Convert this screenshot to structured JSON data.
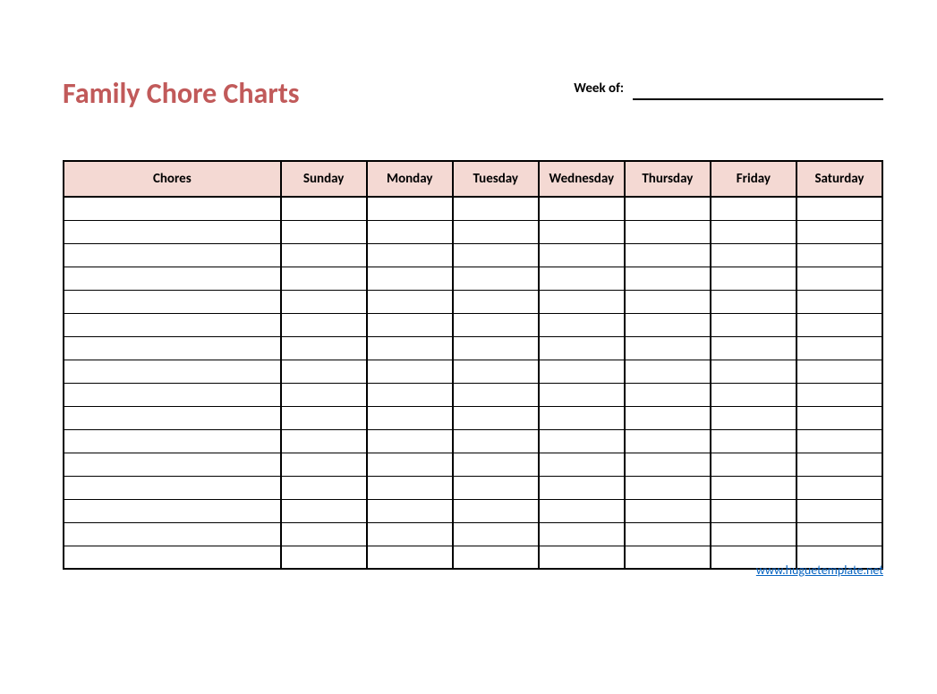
{
  "title": "Family Chore Charts",
  "week_of_label": "Week of:",
  "week_of_value": "",
  "table": {
    "headers": [
      "Chores",
      "Sunday",
      "Monday",
      "Tuesday",
      "Wednesday",
      "Thursday",
      "Friday",
      "Saturday"
    ],
    "row_count": 16
  },
  "footer_link": "www.huguetemplate.net",
  "colors": {
    "title_color": "#c15a5a",
    "header_bg": "#f4d9d3",
    "link_color": "#0563c1"
  },
  "chart_data": {
    "type": "table",
    "title": "Family Chore Charts",
    "columns": [
      "Chores",
      "Sunday",
      "Monday",
      "Tuesday",
      "Wednesday",
      "Thursday",
      "Friday",
      "Saturday"
    ],
    "rows": [
      [
        "",
        "",
        "",
        "",
        "",
        "",
        "",
        ""
      ],
      [
        "",
        "",
        "",
        "",
        "",
        "",
        "",
        ""
      ],
      [
        "",
        "",
        "",
        "",
        "",
        "",
        "",
        ""
      ],
      [
        "",
        "",
        "",
        "",
        "",
        "",
        "",
        ""
      ],
      [
        "",
        "",
        "",
        "",
        "",
        "",
        "",
        ""
      ],
      [
        "",
        "",
        "",
        "",
        "",
        "",
        "",
        ""
      ],
      [
        "",
        "",
        "",
        "",
        "",
        "",
        "",
        ""
      ],
      [
        "",
        "",
        "",
        "",
        "",
        "",
        "",
        ""
      ],
      [
        "",
        "",
        "",
        "",
        "",
        "",
        "",
        ""
      ],
      [
        "",
        "",
        "",
        "",
        "",
        "",
        "",
        ""
      ],
      [
        "",
        "",
        "",
        "",
        "",
        "",
        "",
        ""
      ],
      [
        "",
        "",
        "",
        "",
        "",
        "",
        "",
        ""
      ],
      [
        "",
        "",
        "",
        "",
        "",
        "",
        "",
        ""
      ],
      [
        "",
        "",
        "",
        "",
        "",
        "",
        "",
        ""
      ],
      [
        "",
        "",
        "",
        "",
        "",
        "",
        "",
        ""
      ],
      [
        "",
        "",
        "",
        "",
        "",
        "",
        "",
        ""
      ]
    ]
  }
}
